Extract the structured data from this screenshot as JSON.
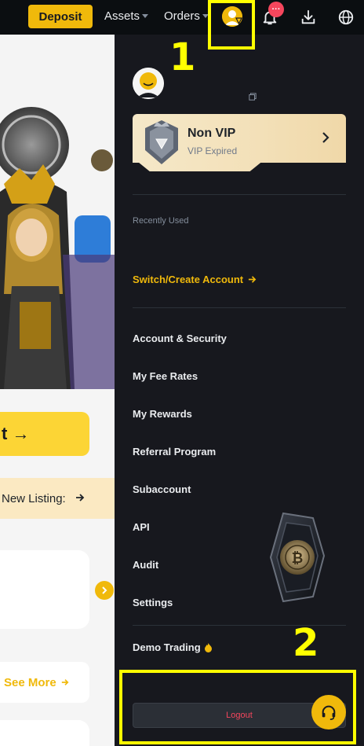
{
  "topbar": {
    "deposit_label": "Deposit",
    "assets_label": "Assets",
    "orders_label": "Orders",
    "notification_count": "···"
  },
  "annotations": {
    "label_1": "1",
    "label_2": "2"
  },
  "background_page": {
    "cta_label": "t →",
    "listing_label": "New Listing:",
    "see_more_label": "See More"
  },
  "dropdown": {
    "vip": {
      "title": "Non VIP",
      "subtitle": "VIP Expired"
    },
    "recently_used_label": "Recently Used",
    "switch_account_label": "Switch/Create Account",
    "menu_items": [
      {
        "label": "Account & Security"
      },
      {
        "label": "My Fee Rates"
      },
      {
        "label": "My Rewards"
      },
      {
        "label": "Referral Program"
      },
      {
        "label": "Subaccount"
      },
      {
        "label": "API"
      },
      {
        "label": "Audit"
      },
      {
        "label": "Settings"
      }
    ],
    "demo_trading_label": "Demo Trading",
    "logout_label": "Logout"
  },
  "colors": {
    "accent": "#f0b90b",
    "panel_bg": "#17181e",
    "logout_text": "#f6465d",
    "annotation": "#ffff00"
  }
}
